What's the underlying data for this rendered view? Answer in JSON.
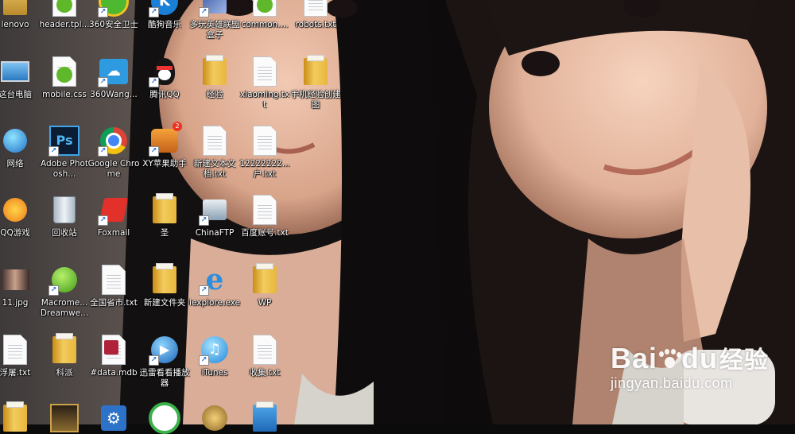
{
  "desktop": {
    "icons": [
      {
        "label": "lenovo"
      },
      {
        "label": "header.tpl..."
      },
      {
        "label": "360安全卫士"
      },
      {
        "label": "酷狗音乐"
      },
      {
        "label": "多玩英雄联盟盒子"
      },
      {
        "label": "common...."
      },
      {
        "label": "robots.txt"
      },
      {
        "label": "这台电脑"
      },
      {
        "label": "mobile.css"
      },
      {
        "label": "360Wang..."
      },
      {
        "label": "腾讯QQ"
      },
      {
        "label": "经验"
      },
      {
        "label": "xiaoming.txt"
      },
      {
        "label": "手机经验创建图"
      },
      {
        "label": "网络"
      },
      {
        "label": "Adobe Photosh..."
      },
      {
        "label": "Google Chrome"
      },
      {
        "label": "XY苹果助手",
        "badge": "2"
      },
      {
        "label": "新建文本文档.txt"
      },
      {
        "label": "12222222...户.txt"
      },
      {
        "label": "QQ游戏"
      },
      {
        "label": "回收站"
      },
      {
        "label": "Foxmail"
      },
      {
        "label": "圣"
      },
      {
        "label": "ChinaFTP"
      },
      {
        "label": "百度账号.txt"
      },
      {
        "label": "11.jpg"
      },
      {
        "label": "Macrome... Dreamwe..."
      },
      {
        "label": "全国省市.txt"
      },
      {
        "label": "新建文件夹"
      },
      {
        "label": "iexplore.exe"
      },
      {
        "label": "WP"
      },
      {
        "label": "浮屠.txt"
      },
      {
        "label": "科派"
      },
      {
        "label": "#data.mdb"
      },
      {
        "label": "迅雷看看播放器"
      },
      {
        "label": "iTunes"
      },
      {
        "label": "收集.txt"
      }
    ]
  },
  "watermark": {
    "brand_left": "Bai",
    "brand_right": "du",
    "brand_suffix": "经验",
    "url": "jingyan.baidu.com"
  }
}
